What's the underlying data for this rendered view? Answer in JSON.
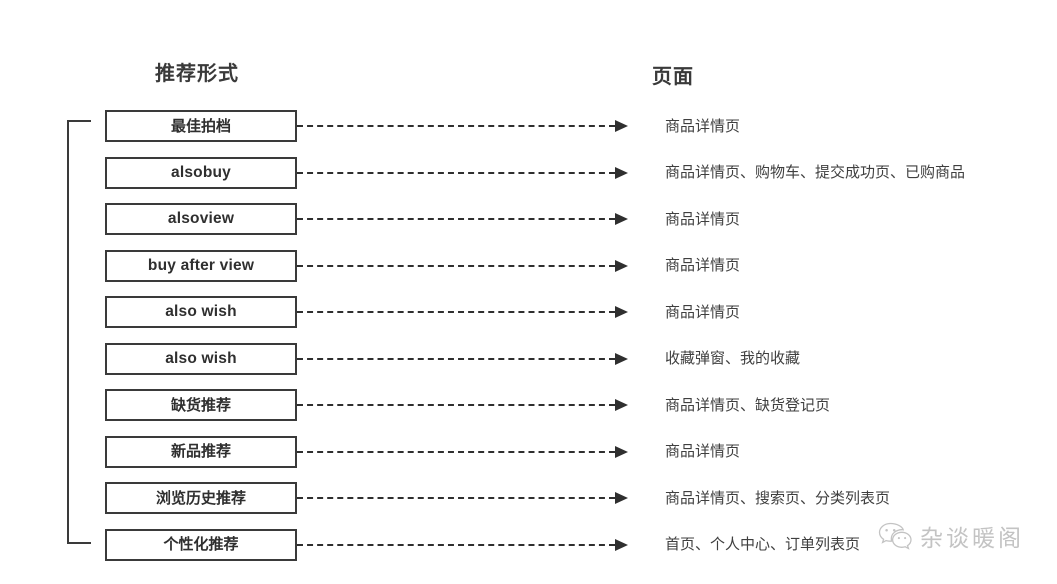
{
  "headers": {
    "form_column": "推荐形式",
    "page_column": "页面"
  },
  "rows": [
    {
      "form": "最佳拍档",
      "script": "han",
      "page": "商品详情页"
    },
    {
      "form": "alsobuy",
      "script": "latin",
      "page": "商品详情页、购物车、提交成功页、已购商品"
    },
    {
      "form": "alsoview",
      "script": "latin",
      "page": "商品详情页"
    },
    {
      "form": "buy after view",
      "script": "latin",
      "page": "商品详情页"
    },
    {
      "form": "also wish",
      "script": "latin",
      "page": "商品详情页"
    },
    {
      "form": "also wish",
      "script": "latin",
      "page": "收藏弹窗、我的收藏"
    },
    {
      "form": "缺货推荐",
      "script": "han",
      "page": "商品详情页、缺货登记页"
    },
    {
      "form": "新品推荐",
      "script": "han",
      "page": "商品详情页"
    },
    {
      "form": "浏览历史推荐",
      "script": "han",
      "page": "商品详情页、搜索页、分类列表页"
    },
    {
      "form": "个性化推荐",
      "script": "han",
      "page": "首页、个人中心、订单列表页"
    }
  ],
  "watermark": {
    "text": "杂谈暖阁",
    "icon": "wechat-icon"
  },
  "colors": {
    "stroke": "#3a3a3a",
    "text": "#3f3f3f",
    "background": "#ffffff"
  }
}
